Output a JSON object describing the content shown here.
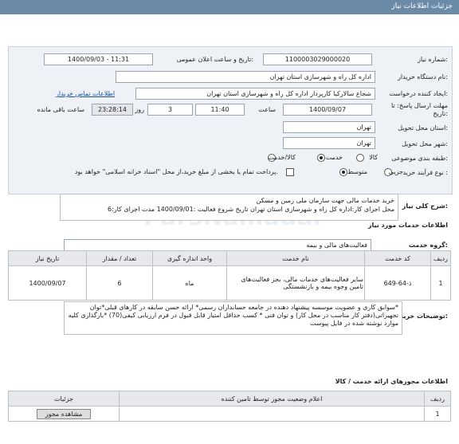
{
  "header": {
    "title": "جزئیات اطلاعات نیاز"
  },
  "form": {
    "need_number_label": "شماره نیاز:",
    "need_number": "1100003029000020",
    "announce_label": "تاریخ و ساعت اعلان عمومی:",
    "announce_value": "1400/09/03 - 11:31",
    "buyer_label": "نام دستگاه خریدار:",
    "buyer": "اداره کل راه و شهرسازی استان تهران",
    "creator_label": "ایجاد کننده درخواست:",
    "creator": "شجاع سالارکیا کارپرداز اداره کل راه و شهرسازی استان تهران",
    "contact_link": "اطلاعات تماس خریدار",
    "deadline_label": "مهلت ارسال پاسخ: تا",
    "deadline_label2": "تاریخ:",
    "deadline_date": "1400/09/07",
    "time_label": "ساعت",
    "deadline_time": "11:40",
    "days": "3",
    "days_label": "روز و",
    "remaining": "23:28:14",
    "remaining_label": "ساعت باقی مانده",
    "province_label": "استان محل تحویل:",
    "province": "تهران",
    "city_label": "شهر محل تحویل:",
    "city": "تهران",
    "category_label": "طبقه بندی موضوعی:",
    "cat_goods": "کالا",
    "cat_service": "خدمت",
    "cat_goods_service": "کالا/خدمت",
    "process_label": "نوع فرآیند خرید :",
    "proc_minor": "جزیی",
    "proc_medium": "متوسط",
    "payment_note": "پرداخت تمام یا بخشی از مبلغ خرید،از محل \"اسناد خزانه اسلامی\" خواهد بود."
  },
  "summary": {
    "label": "شرح کلی نیاز:",
    "line1": "خرید خدمات مالی جهت سازمان ملی زمین و مسکن",
    "line2": "محل اجرای کار:اداره کل راه و شهرسازی استان تهران تاریخ شروع فعالیت :1400/09/01 مدت اجرای کار:6"
  },
  "services": {
    "section_title": "اطلاعات خدمات مورد نیاز",
    "group_label": "گروه خدمت:",
    "group": "فعالیت‌های مالی و بیمه",
    "columns": [
      "ردیف",
      "کد خدمت",
      "نام خدمت",
      "واحد اندازه گیری",
      "تعداد / مقدار",
      "تاریخ نیاز"
    ],
    "rows": [
      [
        "1",
        "ذ-64-649",
        "سایر فعالیت‌های خدمات مالی، بجز فعالیت‌های تامین وجوه بیمه و بازنشستگی",
        "ماه",
        "6",
        "1400/09/07"
      ]
    ]
  },
  "buyer_notes": {
    "label": "توضیحات خریدار:",
    "text": "*سوابق کاری و عضویت موسسه پیشنهاد دهنده در جامعه حسابداران رسمی* ارائه حسن سابقه در کارهای قبلی*توان تجهیزاتی(دفتر کار مناسب در محل کار) و توان فنی * کسب حداقل امتیاز قابل قبول در فرم ارزیابی کیفی(70) *بارگذاری کلیه موارد نوشته شده در فایل پیوست"
  },
  "licenses": {
    "section_title": "اطلاعات مجوزهای ارائه خدمت / کالا",
    "columns": [
      "ردیف",
      "اعلام وضعیت مجوز توسط تامین کننده",
      "جزئیات"
    ],
    "rows": [
      [
        "1",
        "",
        "مشاهده مجوز"
      ]
    ]
  }
}
